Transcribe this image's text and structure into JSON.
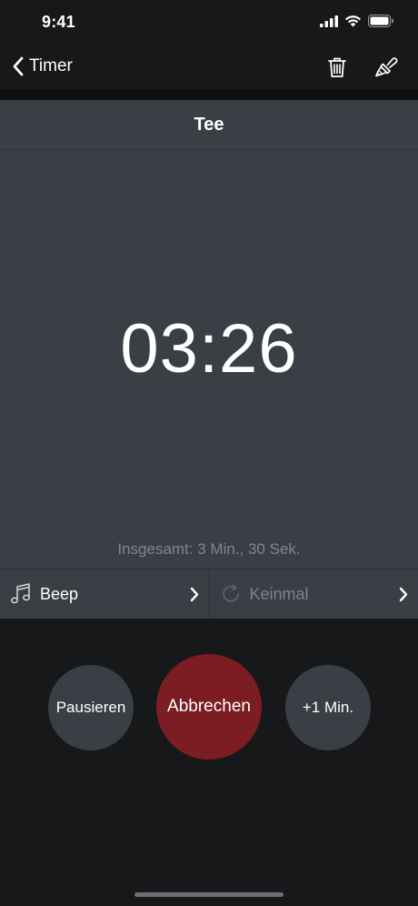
{
  "status_bar": {
    "time": "9:41"
  },
  "nav": {
    "back_label": "Timer",
    "icons": [
      "chevron-left-icon",
      "trash-icon",
      "paint-brush-icon"
    ]
  },
  "timer": {
    "name": "Tee",
    "remaining": "03:26",
    "total": "Insgesamt: 3 Min., 30 Sek."
  },
  "options": {
    "sound": {
      "label": "Beep",
      "icon": "music-note-icon"
    },
    "repeat": {
      "label": "Keinmal",
      "icon": "repeat-icon"
    }
  },
  "controls": {
    "pause_label": "Pausieren",
    "cancel_label": "Abbrechen",
    "add_minute_label": "+1 Min."
  },
  "colors": {
    "background": "#17181a",
    "panel": "#3a3f46",
    "cancel_button": "#7b1d22",
    "secondary_text": "#80868d"
  }
}
